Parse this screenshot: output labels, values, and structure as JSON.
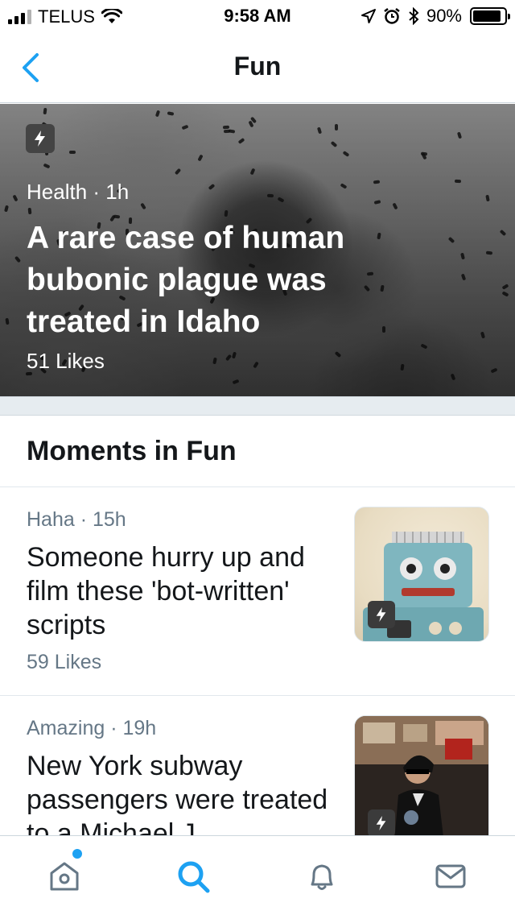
{
  "status_bar": {
    "carrier": "TELUS",
    "time": "9:58 AM",
    "battery": "90%",
    "battery_level": 0.9
  },
  "nav": {
    "title": "Fun",
    "back_icon": "chevron-left-icon"
  },
  "hero": {
    "category": "Health",
    "age": "1h",
    "meta": "Health · 1h",
    "title": "A rare case of human bubonic plague was treated in Idaho",
    "likes": "51 Likes",
    "badge_icon": "lightning-icon"
  },
  "section": {
    "title": "Moments in Fun"
  },
  "moments": [
    {
      "meta": "Haha · 15h",
      "title": "Someone hurry up and film these 'bot-written' scripts",
      "likes": "59 Likes",
      "thumb": "robot-toy-image"
    },
    {
      "meta": "Amazing · 19h",
      "title": "New York subway passengers were treated to a Michael J",
      "likes": "",
      "thumb": "michael-jackson-impersonator-image"
    }
  ],
  "tab_bar": {
    "tabs": [
      "home-icon",
      "search-icon",
      "bell-icon",
      "mail-icon"
    ],
    "active": "search-icon",
    "accent": "#1da1f2",
    "inactive": "#657786"
  },
  "colors": {
    "accent": "#1da1f2",
    "secondary_text": "#657786",
    "primary_text": "#14171a",
    "separator": "#e6ecf0"
  }
}
